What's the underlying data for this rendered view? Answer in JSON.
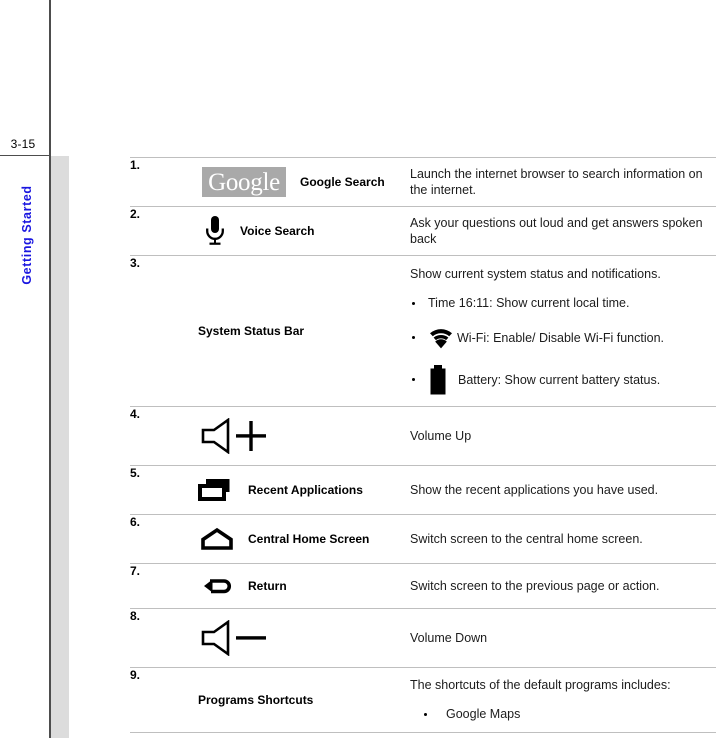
{
  "page": {
    "number": "3-15",
    "chapter": "Getting Started"
  },
  "table": {
    "rows": [
      {
        "num": "1.",
        "icon": "google-logo-icon",
        "logo_text": "Google",
        "label": "Google Search",
        "desc": "Launch the internet browser to search information on the internet."
      },
      {
        "num": "2.",
        "icon": "microphone-icon",
        "label": "Voice Search",
        "desc": "Ask your questions out loud and get answers spoken back"
      },
      {
        "num": "3.",
        "icon": "none",
        "label": "System Status Bar",
        "desc": "Show current system status and notifications.",
        "bullets": [
          {
            "icon": "none",
            "text": "Time 16:11: Show current local time."
          },
          {
            "icon": "wifi-icon",
            "text": "Wi-Fi: Enable/ Disable Wi-Fi function."
          },
          {
            "icon": "battery-icon",
            "text": "Battery: Show current battery status."
          }
        ]
      },
      {
        "num": "4.",
        "icon": "volume-up-icon",
        "label": "",
        "desc": "Volume Up"
      },
      {
        "num": "5.",
        "icon": "recent-applications-icon",
        "label": "Recent Applications",
        "desc": "Show the recent applications you have used."
      },
      {
        "num": "6.",
        "icon": "home-icon",
        "label": "Central Home Screen",
        "desc": "Switch screen to the central home screen."
      },
      {
        "num": "7.",
        "icon": "return-arrow-icon",
        "label": "Return",
        "desc": "Switch screen to the previous page or action."
      },
      {
        "num": "8.",
        "icon": "volume-down-icon",
        "label": "",
        "desc": "Volume Down"
      },
      {
        "num": "9.",
        "icon": "none",
        "label": "Programs Shortcuts",
        "desc": "The shortcuts of the default programs includes:",
        "bullets": [
          {
            "icon": "none",
            "text": "Google Maps"
          }
        ]
      }
    ]
  },
  "colors": {
    "chapter_blue": "#1a16e0",
    "rule_grey": "#bfbfbf",
    "band_grey": "#dcdcdc",
    "google_box_grey": "#a9a9a9"
  }
}
